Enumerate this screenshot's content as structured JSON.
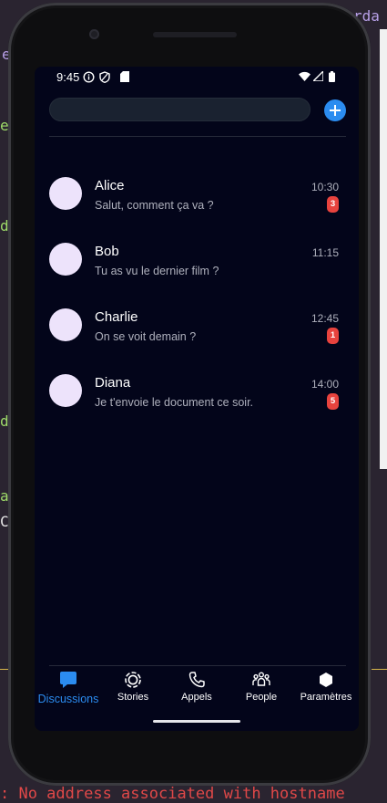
{
  "status_bar": {
    "time": "9:45"
  },
  "conversations": [
    {
      "name": "Alice",
      "message": "Salut, comment ça va ?",
      "time": "10:30",
      "unread": "3"
    },
    {
      "name": "Bob",
      "message": "Tu as vu le dernier film ?",
      "time": "11:15",
      "unread": ""
    },
    {
      "name": "Charlie",
      "message": "On se voit demain ?",
      "time": "12:45",
      "unread": "1"
    },
    {
      "name": "Diana",
      "message": "Je t'envoie le document ce soir.",
      "time": "14:00",
      "unread": "5"
    }
  ],
  "nav": {
    "discussions": "Discussions",
    "stories": "Stories",
    "appels": "Appels",
    "people": "People",
    "parametres": "Paramètres"
  },
  "background": {
    "error_text": ": No address associated with hostname",
    "frag_top_right": "rda",
    "frag_e1": "e",
    "frag_e2": "e",
    "frag_da": "da",
    "frag_do": "do",
    "frag_at": "at",
    "frag_c": "C"
  },
  "colors": {
    "screen_bg": "#03051a",
    "accent": "#2b8cf0",
    "badge": "#e8433e",
    "avatar": "#ede3fb"
  },
  "icons": {
    "status": [
      "info-icon",
      "shield-icon",
      "sim-card-icon",
      "wifi-icon",
      "signal-icon",
      "battery-icon"
    ],
    "nav": [
      "chat-bubble-icon",
      "stories-icon",
      "phone-icon",
      "people-icon",
      "hexagon-icon"
    ],
    "action": "add-icon"
  }
}
